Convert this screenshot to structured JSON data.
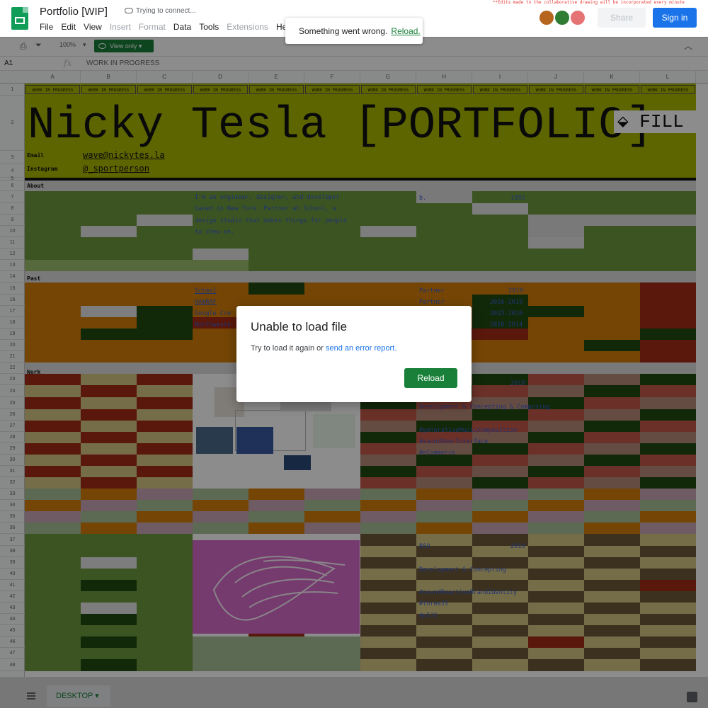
{
  "app": {
    "title": "Portfolio [WIP]",
    "sync_status": "Trying to connect...",
    "menus": [
      "File",
      "Edit",
      "View",
      "Insert",
      "Format",
      "Data",
      "Tools",
      "Extensions",
      "Help"
    ],
    "disabled_menus": [
      "Insert",
      "Format",
      "Extensions"
    ],
    "share_label": "Share",
    "signin_label": "Sign in",
    "warning": "**Edits made to the collaborative drawing will be incorporated every minute"
  },
  "toast": {
    "message": "Something went wrong.",
    "action": "Reload."
  },
  "toolbar": {
    "zoom": "100%",
    "view_only": "View only"
  },
  "formula_bar": {
    "cell_ref": "A1",
    "fx": "fx",
    "value": "WORK IN PROGRESS"
  },
  "columns": [
    "A",
    "B",
    "C",
    "D",
    "E",
    "F",
    "G",
    "H",
    "I",
    "J",
    "K",
    "L"
  ],
  "rows": [
    "1",
    "2",
    "3",
    "4",
    "5",
    "6",
    "7",
    "8",
    "9",
    "10",
    "11",
    "12",
    "13",
    "14",
    "15",
    "16",
    "17",
    "18",
    "19",
    "20",
    "21",
    "22",
    "23",
    "24",
    "25",
    "26",
    "27",
    "28",
    "29",
    "30",
    "31",
    "32",
    "33",
    "34",
    "35",
    "36",
    "37",
    "38",
    "39",
    "40",
    "41",
    "42",
    "43",
    "44",
    "45",
    "46",
    "47",
    "48"
  ],
  "sheet": {
    "wip_label": "WORK IN PROGRESS",
    "title": "Nicky Tesla [PORTFOLIO]",
    "fill_label": "FILL",
    "email_label": "Email",
    "email_value": "wave@nickytes.la",
    "instagram_label": "Instagram",
    "instagram_value": "@_sportperson",
    "about_label": "About",
    "about_lines": [
      "I'm an engineer, designer, and developer",
      "based in New York. Partner at School, a",
      "design studio that makes things for people",
      "to chew on."
    ],
    "born_label": "b.",
    "born_year": "1992",
    "past_label": "Past",
    "past_items": [
      {
        "name": "School",
        "role": "Partner",
        "years": "2019-"
      },
      {
        "name": "HAWRAF",
        "role": "Partner",
        "years": "2016-2019"
      },
      {
        "name": "Google Cre",
        "role": "",
        "years": "2015-2016"
      },
      {
        "name": "Northweste",
        "role": "",
        "years": "2010-2014"
      }
    ],
    "work_label": "Work",
    "work1": {
      "year": "2018",
      "role": "Development & Concepting & Composing",
      "tags": [
        "#generativeMusicComposition",
        "#soundUserInterface",
        "#eCommerce"
      ]
    },
    "work2": {
      "title": "BSO",
      "year": "2019",
      "role": "Development & Concepting",
      "tags": [
        "#soundReactiveBrandIdentity",
        "#threeJS",
        "#p5JS"
      ]
    }
  },
  "dialog": {
    "title": "Unable to load file",
    "body_prefix": "Try to load it again or",
    "body_link": "send an error report.",
    "button": "Reload"
  },
  "bottom": {
    "sheet_tab": "DESKTOP"
  },
  "colors": {
    "lime": "#a9b800",
    "green": "#6d9a3e",
    "darkgreen": "#1f4a12",
    "orange": "#d37e0a",
    "red": "#a52a15",
    "tan": "#d6c584",
    "brown": "#6e5a3a",
    "pink": "#d56bc8",
    "accent": "#188038",
    "blue": "#1a73e8"
  }
}
